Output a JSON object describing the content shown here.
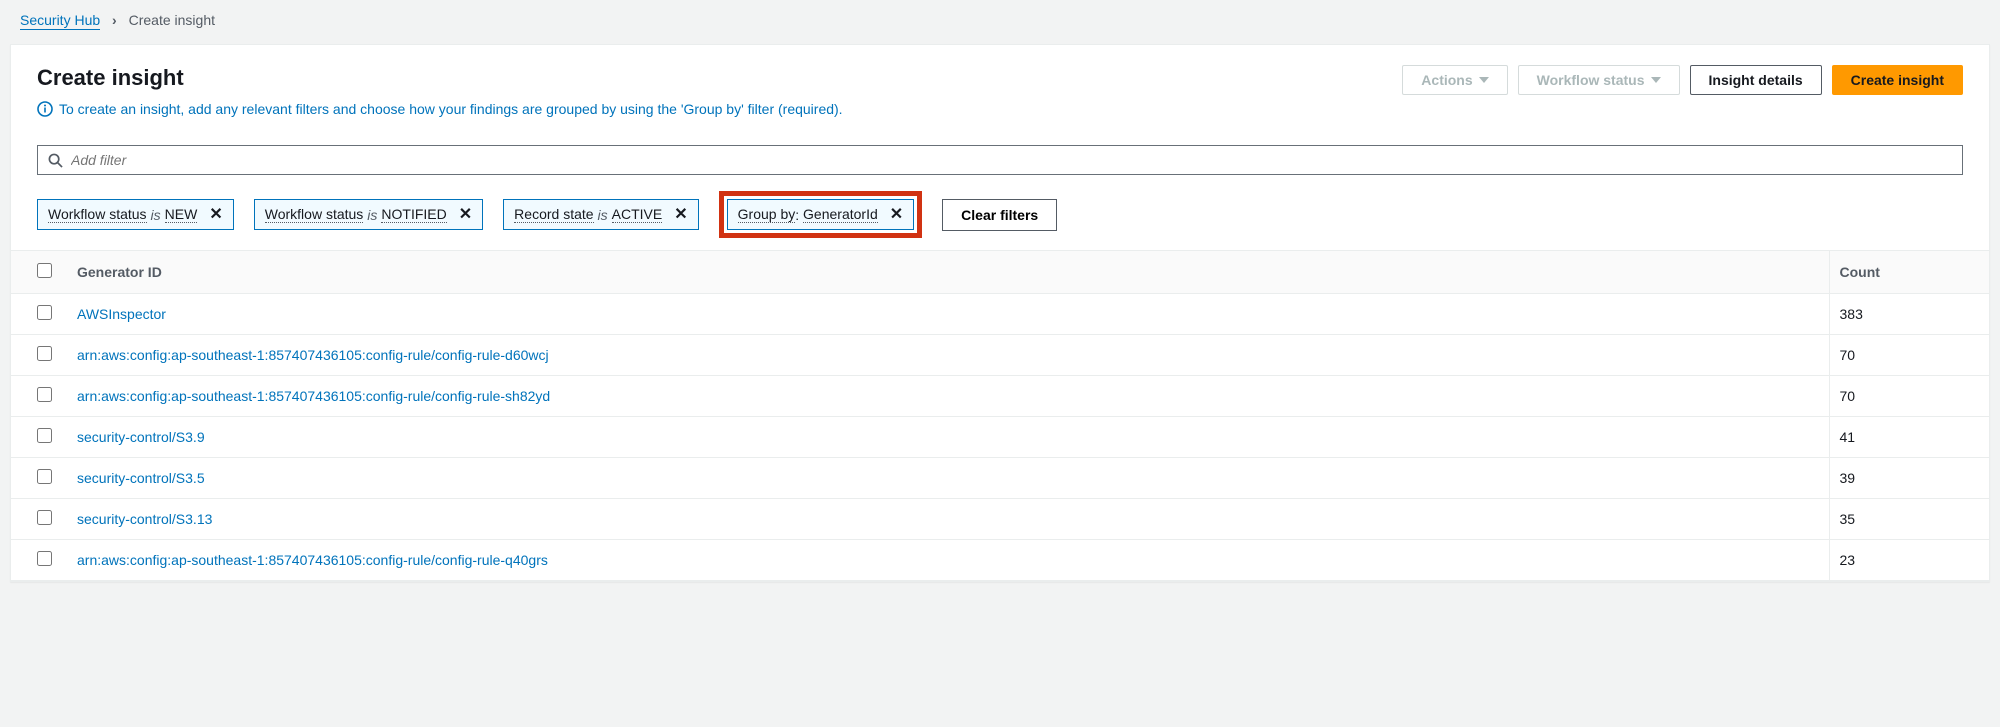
{
  "breadcrumb": {
    "root": "Security Hub",
    "current": "Create insight"
  },
  "header": {
    "title": "Create insight",
    "info_text": "To create an insight, add any relevant filters and choose how your findings are grouped by using the 'Group by' filter (required).",
    "actions_btn": "Actions",
    "workflow_btn": "Workflow status",
    "details_btn": "Insight details",
    "create_btn": "Create insight"
  },
  "filter": {
    "placeholder": "Add filter",
    "chips": [
      {
        "field": "Workflow status",
        "op": "is",
        "value": "NEW"
      },
      {
        "field": "Workflow status",
        "op": "is",
        "value": "NOTIFIED"
      },
      {
        "field": "Record state",
        "op": "is",
        "value": "ACTIVE"
      }
    ],
    "groupby": {
      "label": "Group by",
      "value": "GeneratorId"
    },
    "clear": "Clear filters"
  },
  "table": {
    "col_id": "Generator ID",
    "col_count": "Count",
    "rows": [
      {
        "id": "AWSInspector",
        "count": "383"
      },
      {
        "id": "arn:aws:config:ap-southeast-1:857407436105:config-rule/config-rule-d60wcj",
        "count": "70"
      },
      {
        "id": "arn:aws:config:ap-southeast-1:857407436105:config-rule/config-rule-sh82yd",
        "count": "70"
      },
      {
        "id": "security-control/S3.9",
        "count": "41"
      },
      {
        "id": "security-control/S3.5",
        "count": "39"
      },
      {
        "id": "security-control/S3.13",
        "count": "35"
      },
      {
        "id": "arn:aws:config:ap-southeast-1:857407436105:config-rule/config-rule-q40grs",
        "count": "23"
      }
    ]
  }
}
